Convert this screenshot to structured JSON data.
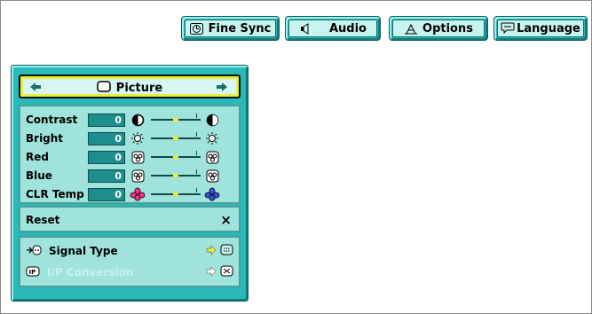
{
  "tabs": [
    {
      "label": "Fine Sync",
      "icon": "fine-sync-icon"
    },
    {
      "label": "Audio",
      "icon": "speaker-icon"
    },
    {
      "label": "Options",
      "icon": "options-icon"
    },
    {
      "label": "Language",
      "icon": "speech-bubble-icon"
    }
  ],
  "panel": {
    "title": "Picture",
    "adjustments": [
      {
        "label": "Contrast",
        "value": "0",
        "icon": "contrast-icon",
        "level": 0.5
      },
      {
        "label": "Bright",
        "value": "0",
        "icon": "brightness-icon",
        "level": 0.5
      },
      {
        "label": "Red",
        "value": "0",
        "icon": "red-color-icon",
        "level": 0.5
      },
      {
        "label": "Blue",
        "value": "0",
        "icon": "blue-color-icon",
        "level": 0.5
      },
      {
        "label": "CLR Temp",
        "value": "0",
        "icon": "color-temp-icon",
        "level": 0.5
      }
    ],
    "reset_label": "Reset",
    "reset_symbol": "×",
    "signal_type_label": "Signal Type",
    "ip_conversion_label": "I/P Conversion"
  },
  "colors": {
    "panel": "#2bb8b8",
    "box": "#9fe3dc",
    "value_box": "#1e8e8c",
    "accent": "#e8ee3a"
  }
}
